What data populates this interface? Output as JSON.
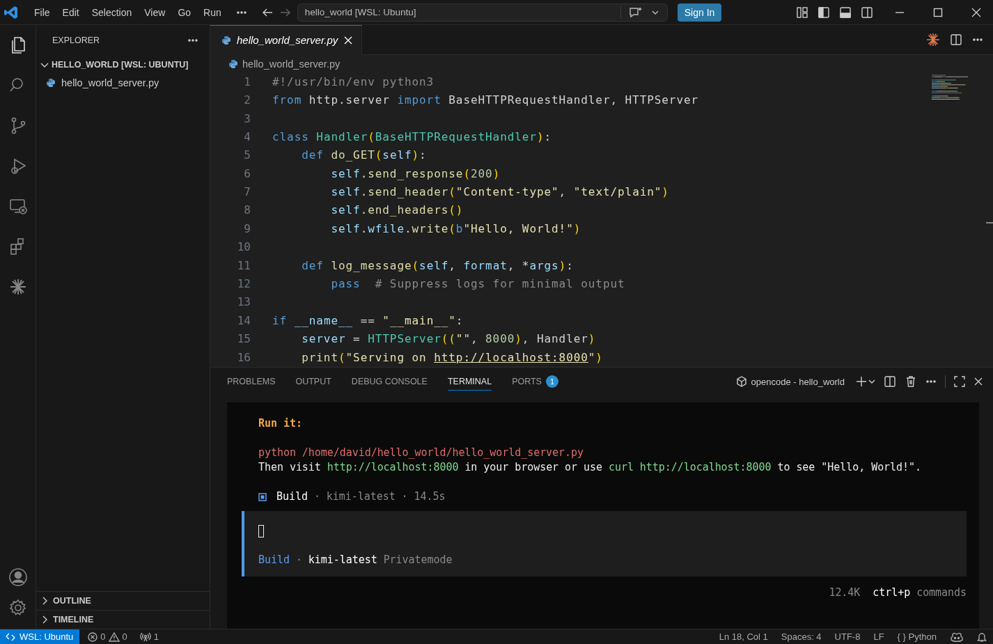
{
  "title_bar": {
    "menu": [
      "File",
      "Edit",
      "Selection",
      "View",
      "Go",
      "Run"
    ],
    "command_center": "hello_world [WSL: Ubuntu]",
    "sign_in": "Sign In"
  },
  "activity_bar": {
    "items": [
      {
        "kind": "files",
        "selected": true
      },
      {
        "kind": "search",
        "selected": false
      },
      {
        "kind": "source-control",
        "selected": false
      },
      {
        "kind": "run-debug",
        "selected": false
      },
      {
        "kind": "remote",
        "selected": false
      },
      {
        "kind": "extensions",
        "selected": false
      },
      {
        "kind": "spark",
        "selected": false
      }
    ],
    "bottom": [
      {
        "kind": "account"
      },
      {
        "kind": "settings"
      }
    ]
  },
  "sidebar": {
    "title": "EXPLORER",
    "folder": {
      "label": "HELLO_WORLD [WSL: UBUNTU]",
      "expanded": true,
      "children": [
        {
          "label": "hello_world_server.py"
        }
      ]
    },
    "sections": [
      {
        "label": "OUTLINE",
        "expanded": false
      },
      {
        "label": "TIMELINE",
        "expanded": false
      }
    ]
  },
  "editor": {
    "tabs": [
      {
        "label": "hello_world_server.py",
        "selected": true,
        "preview": true
      }
    ],
    "breadcrumb": "hello_world_server.py",
    "lines": [
      {
        "number": "1",
        "tokens": [
          {
            "text": "#!/usr/bin/env python3",
            "kind": "comment"
          }
        ]
      },
      {
        "number": "2",
        "tokens": [
          {
            "text": "from",
            "kind": "keyword"
          },
          {
            "text": " http.server ",
            "kind": "plain"
          },
          {
            "text": "import",
            "kind": "keyword"
          },
          {
            "text": " BaseHTTPRequestHandler, HTTPServer",
            "kind": "plain"
          }
        ]
      },
      {
        "number": "3"
      },
      {
        "number": "4",
        "tokens": [
          {
            "text": "class ",
            "kind": "keyword"
          },
          {
            "text": "Handler",
            "kind": "class"
          },
          {
            "text": "(",
            "kind": "bracket"
          },
          {
            "text": "BaseHTTPRequestHandler",
            "kind": "class"
          },
          {
            "text": ")",
            "kind": "bracket"
          },
          {
            "text": ":",
            "kind": "plain"
          }
        ]
      },
      {
        "number": "5",
        "tokens": [
          {
            "text": "    def ",
            "kind": "keyword"
          },
          {
            "text": "do_GET",
            "kind": "function"
          },
          {
            "text": "(",
            "kind": "bracket"
          },
          {
            "text": "self",
            "kind": "param"
          },
          {
            "text": ")",
            "kind": "bracket"
          },
          {
            "text": ":",
            "kind": "plain"
          }
        ]
      },
      {
        "number": "6",
        "tokens": [
          {
            "text": "        self",
            "kind": "param"
          },
          {
            "text": ".",
            "kind": "plain"
          },
          {
            "text": "send_response",
            "kind": "function"
          },
          {
            "text": "(",
            "kind": "bracket"
          },
          {
            "text": "200",
            "kind": "number"
          },
          {
            "text": ")",
            "kind": "bracket"
          }
        ]
      },
      {
        "number": "7",
        "tokens": [
          {
            "text": "        self",
            "kind": "param"
          },
          {
            "text": ".",
            "kind": "plain"
          },
          {
            "text": "send_header",
            "kind": "function"
          },
          {
            "text": "(",
            "kind": "bracket"
          },
          {
            "text": "\"Content-type\"",
            "kind": "string"
          },
          {
            "text": ", ",
            "kind": "plain"
          },
          {
            "text": "\"text/plain\"",
            "kind": "string"
          },
          {
            "text": ")",
            "kind": "bracket"
          }
        ]
      },
      {
        "number": "8",
        "tokens": [
          {
            "text": "        self",
            "kind": "param"
          },
          {
            "text": ".",
            "kind": "plain"
          },
          {
            "text": "end_headers",
            "kind": "function"
          },
          {
            "text": "()",
            "kind": "bracket"
          }
        ]
      },
      {
        "number": "9",
        "tokens": [
          {
            "text": "        self",
            "kind": "param"
          },
          {
            "text": ".",
            "kind": "plain"
          },
          {
            "text": "wfile",
            "kind": "param"
          },
          {
            "text": ".",
            "kind": "plain"
          },
          {
            "text": "write",
            "kind": "function"
          },
          {
            "text": "(",
            "kind": "bracket"
          },
          {
            "text": "b",
            "kind": "keyword"
          },
          {
            "text": "\"Hello, World!\"",
            "kind": "string"
          },
          {
            "text": ")",
            "kind": "bracket"
          }
        ]
      },
      {
        "number": "10"
      },
      {
        "number": "11",
        "tokens": [
          {
            "text": "    def ",
            "kind": "keyword"
          },
          {
            "text": "log_message",
            "kind": "function"
          },
          {
            "text": "(",
            "kind": "bracket"
          },
          {
            "text": "self",
            "kind": "param"
          },
          {
            "text": ", ",
            "kind": "plain"
          },
          {
            "text": "format",
            "kind": "param"
          },
          {
            "text": ", *",
            "kind": "plain"
          },
          {
            "text": "args",
            "kind": "param"
          },
          {
            "text": ")",
            "kind": "bracket"
          },
          {
            "text": ":",
            "kind": "plain"
          }
        ]
      },
      {
        "number": "12",
        "tokens": [
          {
            "text": "        pass",
            "kind": "keyword"
          },
          {
            "text": "  # Suppress logs for minimal output",
            "kind": "comment"
          }
        ]
      },
      {
        "number": "13"
      },
      {
        "number": "14",
        "tokens": [
          {
            "text": "if ",
            "kind": "keyword"
          },
          {
            "text": "__name__",
            "kind": "param"
          },
          {
            "text": " == ",
            "kind": "plain"
          },
          {
            "text": "\"__main__\"",
            "kind": "string"
          },
          {
            "text": ":",
            "kind": "plain"
          }
        ]
      },
      {
        "number": "15",
        "tokens": [
          {
            "text": "    server",
            "kind": "param"
          },
          {
            "text": " = ",
            "kind": "plain"
          },
          {
            "text": "HTTPServer",
            "kind": "class"
          },
          {
            "text": "((",
            "kind": "bracket"
          },
          {
            "text": "\"\"",
            "kind": "string"
          },
          {
            "text": ", ",
            "kind": "plain"
          },
          {
            "text": "8000",
            "kind": "number"
          },
          {
            "text": ")",
            "kind": "bracket"
          },
          {
            "text": ", Handler",
            "kind": "plain"
          },
          {
            "text": ")",
            "kind": "bracket"
          }
        ]
      },
      {
        "number": "16",
        "tokens": [
          {
            "text": "    print",
            "kind": "function"
          },
          {
            "text": "(",
            "kind": "bracket"
          },
          {
            "text": "\"Serving on ",
            "kind": "string"
          },
          {
            "text": "http://localhost:8000",
            "kind": "link"
          },
          {
            "text": "\"",
            "kind": "string"
          },
          {
            "text": ")",
            "kind": "bracket"
          }
        ]
      }
    ]
  },
  "panel": {
    "tabs": [
      {
        "label": "PROBLEMS",
        "selected": false
      },
      {
        "label": "OUTPUT",
        "selected": false
      },
      {
        "label": "DEBUG CONSOLE",
        "selected": false
      },
      {
        "label": "TERMINAL",
        "selected": true
      },
      {
        "label": "PORTS",
        "selected": false,
        "badge": "1"
      }
    ],
    "terminal_name": "opencode - hello_world",
    "terminal": {
      "heading": "Run it:",
      "command": "python /home/david/hello_world/hello_world_server.py",
      "message": [
        {
          "text": "Then visit ",
          "kind": "text"
        },
        {
          "text": "http://localhost:8000",
          "kind": "link"
        },
        {
          "text": " in your browser or use ",
          "kind": "text"
        },
        {
          "text": "curl http://localhost:8000",
          "kind": "link"
        },
        {
          "text": " to see \"Hello, World!\".",
          "kind": "text"
        }
      ],
      "status": {
        "mode": "Build",
        "detail": "· kimi-latest · 14.5s"
      },
      "prompt": {
        "mode": "Build",
        "separator": "·",
        "model": "kimi-latest",
        "provider": "Privatemode"
      },
      "footer": {
        "tokens": "12.4K",
        "shortcut": "ctrl+p",
        "shortcut_label": "commands"
      }
    }
  },
  "status_bar": {
    "remote": "WSL: Ubuntu",
    "errors": "0",
    "warnings": "0",
    "ports": "1",
    "items": [
      "Ln 18, Col 1",
      "Spaces: 4",
      "UTF-8",
      "LF"
    ],
    "language_icon": "{ }",
    "language": "Python"
  }
}
